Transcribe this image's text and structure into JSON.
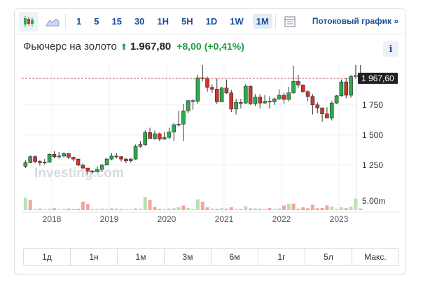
{
  "toolbar": {
    "chart_types": [
      {
        "icon": "candlestick-icon",
        "active": true
      },
      {
        "icon": "area-chart-icon",
        "active": false
      }
    ],
    "intervals": [
      {
        "label": "1",
        "active": false
      },
      {
        "label": "5",
        "active": false
      },
      {
        "label": "15",
        "active": false
      },
      {
        "label": "30",
        "active": false
      },
      {
        "label": "1H",
        "active": false
      },
      {
        "label": "5H",
        "active": false
      },
      {
        "label": "1D",
        "active": false
      },
      {
        "label": "1W",
        "active": false
      },
      {
        "label": "1M",
        "active": true
      }
    ],
    "table_icon": "table-icon",
    "streaming_label": "Потоковый график »"
  },
  "instrument": {
    "name": "Фьючерс на золото",
    "last": "1.967,80",
    "change": "+8,00",
    "change_pct": "(+0,41%)",
    "info_label": "i"
  },
  "watermark": "Investing.com",
  "colors": {
    "up": "#2fa84f",
    "down": "#d0352b",
    "up_fill": "#b8e0b0",
    "down_fill": "#f2a5a0",
    "accent": "#1a4e9b"
  },
  "chart_data": {
    "type": "candlestick",
    "price_label": "1 967,60",
    "y_ticks": [
      {
        "value": 1750,
        "label": "1 750"
      },
      {
        "value": 1500,
        "label": "1 500"
      },
      {
        "value": 1250,
        "label": "1 250"
      }
    ],
    "volume_label": "5.00m",
    "x_ticks": [
      {
        "year": 2018,
        "label": "2018"
      },
      {
        "year": 2019,
        "label": "2019"
      },
      {
        "year": 2020,
        "label": "2020"
      },
      {
        "year": 2021,
        "label": "2021"
      },
      {
        "year": 2022,
        "label": "2022"
      },
      {
        "year": 2023,
        "label": "2023"
      }
    ],
    "ylim": [
      1080,
      2080
    ],
    "start": "2017-07",
    "ohlc": [
      [
        1240,
        1290,
        1225,
        1270
      ],
      [
        1270,
        1330,
        1265,
        1320
      ],
      [
        1320,
        1330,
        1265,
        1280
      ],
      [
        1280,
        1290,
        1245,
        1270
      ],
      [
        1270,
        1300,
        1255,
        1275
      ],
      [
        1275,
        1345,
        1270,
        1340
      ],
      [
        1340,
        1365,
        1305,
        1320
      ],
      [
        1320,
        1360,
        1305,
        1325
      ],
      [
        1325,
        1355,
        1315,
        1345
      ],
      [
        1345,
        1350,
        1300,
        1315
      ],
      [
        1315,
        1320,
        1280,
        1300
      ],
      [
        1300,
        1305,
        1240,
        1250
      ],
      [
        1250,
        1265,
        1210,
        1225
      ],
      [
        1225,
        1225,
        1170,
        1200
      ],
      [
        1200,
        1210,
        1180,
        1195
      ],
      [
        1195,
        1240,
        1190,
        1215
      ],
      [
        1215,
        1260,
        1195,
        1250
      ],
      [
        1250,
        1310,
        1250,
        1300
      ],
      [
        1300,
        1350,
        1290,
        1325
      ],
      [
        1325,
        1350,
        1305,
        1320
      ],
      [
        1320,
        1325,
        1280,
        1300
      ],
      [
        1300,
        1310,
        1265,
        1285
      ],
      [
        1285,
        1310,
        1270,
        1300
      ],
      [
        1300,
        1420,
        1295,
        1405
      ],
      [
        1405,
        1450,
        1395,
        1420
      ],
      [
        1420,
        1540,
        1410,
        1520
      ],
      [
        1520,
        1560,
        1490,
        1470
      ],
      [
        1470,
        1535,
        1460,
        1510
      ],
      [
        1510,
        1520,
        1450,
        1465
      ],
      [
        1465,
        1525,
        1460,
        1480
      ],
      [
        1480,
        1560,
        1465,
        1525
      ],
      [
        1525,
        1600,
        1450,
        1585
      ],
      [
        1585,
        1700,
        1570,
        1590
      ],
      [
        1590,
        1760,
        1450,
        1700
      ],
      [
        1700,
        1790,
        1680,
        1785
      ],
      [
        1785,
        1800,
        1710,
        1780
      ],
      [
        1780,
        2000,
        1760,
        1975
      ],
      [
        1975,
        2080,
        1945,
        1970
      ],
      [
        1970,
        1985,
        1860,
        1895
      ],
      [
        1895,
        1920,
        1850,
        1880
      ],
      [
        1880,
        1970,
        1760,
        1775
      ],
      [
        1775,
        1900,
        1780,
        1890
      ],
      [
        1890,
        1960,
        1840,
        1850
      ],
      [
        1850,
        1875,
        1690,
        1715
      ],
      [
        1715,
        1800,
        1670,
        1770
      ],
      [
        1770,
        1800,
        1720,
        1765
      ],
      [
        1765,
        1920,
        1760,
        1905
      ],
      [
        1905,
        1910,
        1750,
        1760
      ],
      [
        1760,
        1840,
        1740,
        1815
      ],
      [
        1815,
        1840,
        1720,
        1765
      ],
      [
        1765,
        1830,
        1760,
        1780
      ],
      [
        1780,
        1820,
        1720,
        1775
      ],
      [
        1775,
        1810,
        1750,
        1800
      ],
      [
        1800,
        1880,
        1790,
        1830
      ],
      [
        1830,
        1850,
        1760,
        1795
      ],
      [
        1795,
        1900,
        1780,
        1850
      ],
      [
        1850,
        2075,
        1840,
        1945
      ],
      [
        1945,
        2000,
        1890,
        1915
      ],
      [
        1915,
        1920,
        1850,
        1860
      ],
      [
        1860,
        1870,
        1780,
        1820
      ],
      [
        1820,
        1840,
        1670,
        1750
      ],
      [
        1750,
        1770,
        1680,
        1725
      ],
      [
        1725,
        1725,
        1610,
        1675
      ],
      [
        1675,
        1730,
        1650,
        1640
      ],
      [
        1640,
        1780,
        1620,
        1765
      ],
      [
        1765,
        1830,
        1760,
        1825
      ],
      [
        1825,
        1960,
        1820,
        1940
      ],
      [
        1940,
        1975,
        1805,
        1830
      ],
      [
        1830,
        2000,
        1810,
        1985
      ],
      [
        1985,
        2080,
        1970,
        1995
      ],
      [
        1995,
        2080,
        1930,
        1970
      ]
    ],
    "volume": [
      [
        0.8,
        1
      ],
      [
        0.65,
        0
      ],
      [
        0.08,
        1
      ],
      [
        0.1,
        0
      ],
      [
        0.06,
        1
      ],
      [
        0.09,
        1
      ],
      [
        0.12,
        0
      ],
      [
        0.05,
        1
      ],
      [
        0.07,
        1
      ],
      [
        0.1,
        0
      ],
      [
        0.06,
        0
      ],
      [
        0.08,
        0
      ],
      [
        0.55,
        0
      ],
      [
        0.4,
        0
      ],
      [
        0.08,
        1
      ],
      [
        0.07,
        1
      ],
      [
        0.1,
        1
      ],
      [
        0.06,
        1
      ],
      [
        0.12,
        1
      ],
      [
        0.08,
        0
      ],
      [
        0.06,
        0
      ],
      [
        0.07,
        1
      ],
      [
        0.05,
        1
      ],
      [
        0.12,
        1
      ],
      [
        0.09,
        1
      ],
      [
        0.85,
        1
      ],
      [
        0.65,
        0
      ],
      [
        0.2,
        0
      ],
      [
        0.08,
        0
      ],
      [
        0.06,
        1
      ],
      [
        0.1,
        1
      ],
      [
        0.12,
        1
      ],
      [
        0.18,
        1
      ],
      [
        0.3,
        0
      ],
      [
        0.14,
        1
      ],
      [
        0.08,
        1
      ],
      [
        0.7,
        1
      ],
      [
        0.55,
        0
      ],
      [
        0.18,
        0
      ],
      [
        0.1,
        1
      ],
      [
        0.08,
        0
      ],
      [
        0.12,
        1
      ],
      [
        0.09,
        0
      ],
      [
        0.18,
        0
      ],
      [
        0.08,
        1
      ],
      [
        0.07,
        0
      ],
      [
        0.25,
        1
      ],
      [
        0.1,
        0
      ],
      [
        0.12,
        1
      ],
      [
        0.08,
        0
      ],
      [
        0.09,
        1
      ],
      [
        0.14,
        0
      ],
      [
        0.08,
        1
      ],
      [
        0.1,
        1
      ],
      [
        0.3,
        0
      ],
      [
        0.4,
        1
      ],
      [
        0.42,
        0
      ],
      [
        0.09,
        0
      ],
      [
        0.18,
        0
      ],
      [
        0.12,
        0
      ],
      [
        0.35,
        0
      ],
      [
        0.12,
        0
      ],
      [
        0.14,
        0
      ],
      [
        0.3,
        0
      ],
      [
        0.22,
        1
      ],
      [
        0.08,
        1
      ],
      [
        0.18,
        1
      ],
      [
        0.12,
        0
      ],
      [
        0.22,
        1
      ],
      [
        0.75,
        1
      ],
      [
        0.1,
        0
      ]
    ]
  },
  "periods": [
    "1д",
    "1н",
    "1м",
    "3м",
    "6м",
    "1г",
    "5л",
    "Макс."
  ]
}
